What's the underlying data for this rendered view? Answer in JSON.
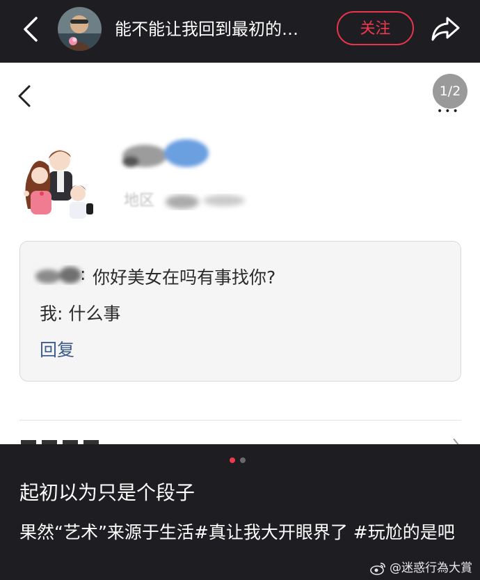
{
  "topbar": {
    "title": "能不能让我回到最初的…",
    "follow_label": "关注"
  },
  "content": {
    "page_indicator": "1/2",
    "region_label": "地区",
    "message": {
      "line1": "你好美女在吗有事找你?",
      "line2": "我: 什么事",
      "reply_label": "回复"
    }
  },
  "carousel": {
    "current": 1,
    "total": 2,
    "active_color": "#f0384f",
    "inactive_color": "#6a6a6a"
  },
  "caption": {
    "title": "起初以为只是个段子",
    "body": "果然“艺术”来源于生活#真让我大开眼界了 #玩尬的是吧"
  },
  "watermark": {
    "text": "@迷惑行為大賞"
  },
  "colors": {
    "accent": "#f0384f",
    "dark_bg": "#1e1e22",
    "link": "#3d5b8c"
  }
}
